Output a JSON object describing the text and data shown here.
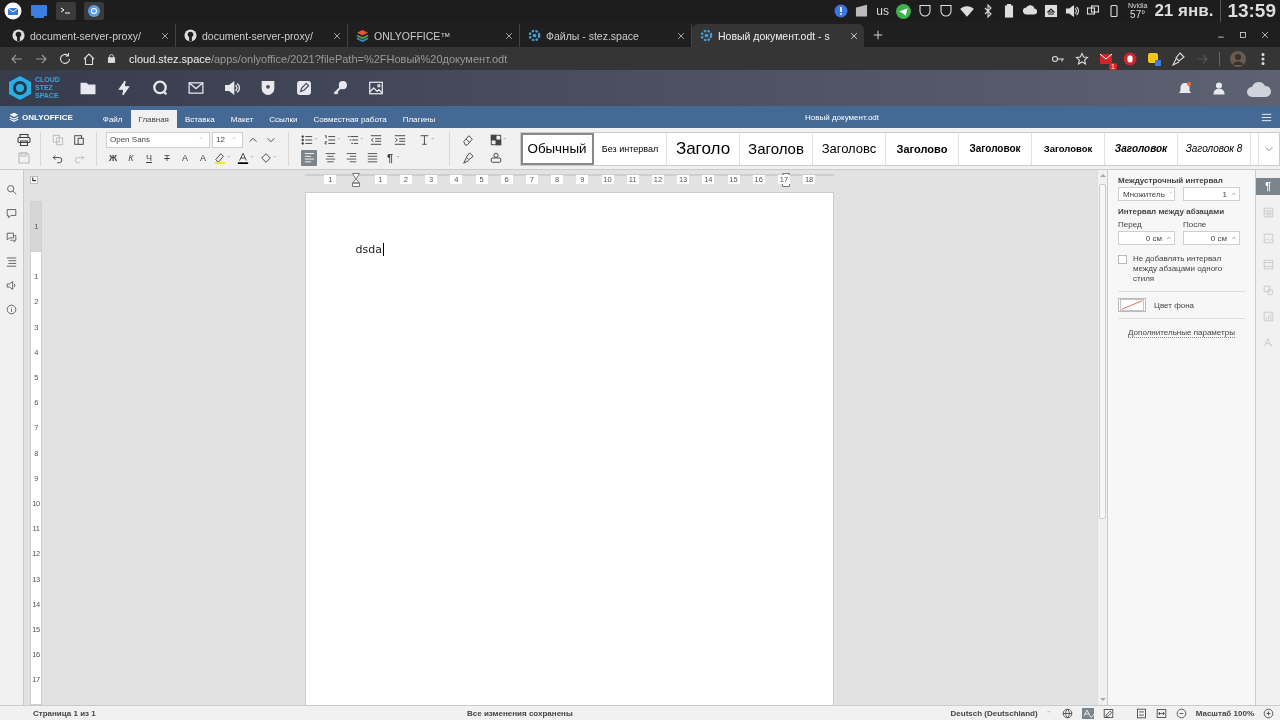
{
  "os_panel": {
    "keyboard_layout": "us",
    "gpu_label": "Nvidia",
    "gpu_temp": "57°",
    "date": "21 янв.",
    "time": "13:59"
  },
  "browser": {
    "tabs": [
      {
        "title": "document-server-proxy/",
        "kind": "github",
        "selected": false
      },
      {
        "title": "document-server-proxy/",
        "kind": "github",
        "selected": false
      },
      {
        "title": "ONLYOFFICE™",
        "kind": "stack",
        "selected": false
      },
      {
        "title": "Файлы - stez.space",
        "kind": "cloud",
        "selected": false
      },
      {
        "title": "Новый документ.odt - s",
        "kind": "cloud",
        "selected": true
      }
    ],
    "address": {
      "host": "cloud.stez.space",
      "path": "/apps/onlyoffice/2021?filePath=%2FНовый%20документ.odt"
    },
    "extension_badge": "1"
  },
  "cloud_header": {
    "logo_lines": [
      "CLOUD",
      "STEZ",
      "SPACE"
    ]
  },
  "editor": {
    "brand": "ONLYOFFICE",
    "tabs": [
      {
        "label": "Файл",
        "selected": false
      },
      {
        "label": "Главная",
        "selected": true
      },
      {
        "label": "Вставка",
        "selected": false
      },
      {
        "label": "Макет",
        "selected": false
      },
      {
        "label": "Ссылки",
        "selected": false
      },
      {
        "label": "Совместная работа",
        "selected": false
      },
      {
        "label": "Плагины",
        "selected": false
      }
    ],
    "document_title": "Новый документ.odt"
  },
  "toolbar": {
    "font": "Open Sans",
    "size": "12",
    "format_buttons": [
      {
        "kind": "bold",
        "label": "Ж"
      },
      {
        "kind": "italic",
        "label": "К"
      },
      {
        "kind": "underline",
        "label": "Ч"
      },
      {
        "kind": "strike",
        "label": "Т"
      },
      {
        "kind": "superscript",
        "label": "A"
      },
      {
        "kind": "subscript",
        "label": "A"
      }
    ],
    "alignment": [
      {
        "kind": "left",
        "selected": true
      },
      {
        "kind": "center",
        "selected": false
      },
      {
        "kind": "right",
        "selected": false
      },
      {
        "kind": "justify",
        "selected": false
      }
    ],
    "nonprinting_label": "¶",
    "styles": [
      {
        "label": "Обычный",
        "kind": "normal",
        "selected": true
      },
      {
        "label": "Без интервал",
        "kind": "nospacing",
        "selected": false
      },
      {
        "label": "Заголо",
        "kind": "h1",
        "selected": false
      },
      {
        "label": "Заголов",
        "kind": "h2",
        "selected": false
      },
      {
        "label": "Заголовс",
        "kind": "h3",
        "selected": false
      },
      {
        "label": "Заголово",
        "kind": "h4",
        "selected": false
      },
      {
        "label": "Заголовок",
        "kind": "h5",
        "selected": false
      },
      {
        "label": "Заголовок",
        "kind": "h6",
        "selected": false
      },
      {
        "label": "Заголовок",
        "kind": "h7",
        "selected": false
      },
      {
        "label": "Заголовок 8",
        "kind": "h8",
        "selected": false
      }
    ]
  },
  "ruler": {
    "horizontal_labels": [
      "1",
      "1",
      "2",
      "3",
      "4",
      "5",
      "6",
      "7",
      "8",
      "9",
      "10",
      "11",
      "12",
      "13",
      "14",
      "15",
      "16",
      "17",
      "18"
    ],
    "vertical_labels": [
      "1",
      "1",
      "2",
      "3",
      "4",
      "5",
      "6",
      "7",
      "8",
      "9",
      "10",
      "11",
      "12",
      "13",
      "14",
      "15",
      "16",
      "17"
    ]
  },
  "document": {
    "text": "dsda"
  },
  "paragraph_panel": {
    "line_spacing_title": "Междустрочный интервал",
    "line_spacing_mode": "Множитель",
    "line_spacing_value": "1",
    "paragraph_spacing_title": "Интервал между абзацами",
    "before_label": "Перед",
    "after_label": "После",
    "before_value": "0 см",
    "after_value": "0 см",
    "no_spacing_same_style": {
      "label": "Не добавлять интервал между абзацами одного стиля",
      "checked": false
    },
    "background_color_label": "Цвет фона",
    "advanced_link": "Дополнительные параметры"
  },
  "right_rail": [
    {
      "kind": "paragraph",
      "label": "¶",
      "selected": true
    },
    {
      "kind": "table",
      "selected": false
    },
    {
      "kind": "image",
      "selected": false
    },
    {
      "kind": "header",
      "selected": false
    },
    {
      "kind": "shape",
      "selected": false
    },
    {
      "kind": "chart",
      "selected": false
    },
    {
      "kind": "textart",
      "selected": false
    }
  ],
  "status_bar": {
    "page": "Страница 1 из 1",
    "save_state": "Все изменения сохранены",
    "language": "Deutsch (Deutschland)",
    "zoom": "Масштаб 100%"
  }
}
